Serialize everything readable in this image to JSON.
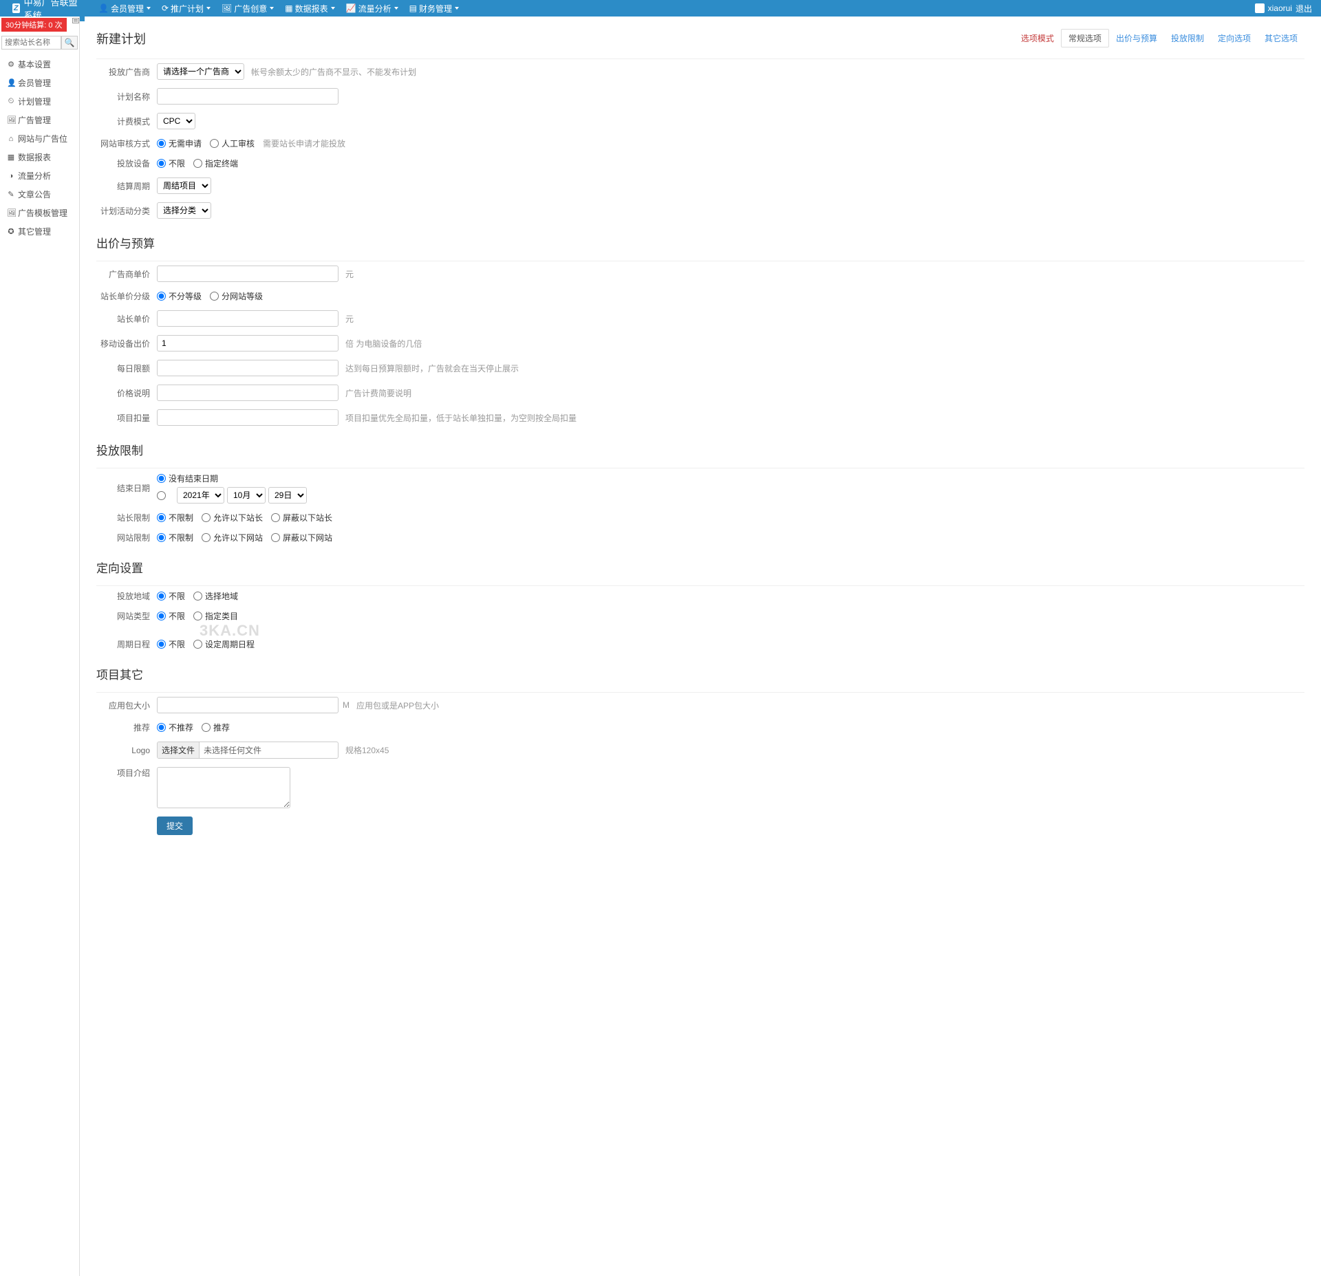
{
  "brand": "中易广告联盟系统",
  "topnav": [
    {
      "icon": "👤",
      "label": "会员管理"
    },
    {
      "icon": "⟳",
      "label": "推广计划"
    },
    {
      "icon": "🖼",
      "label": "广告创意"
    },
    {
      "icon": "▦",
      "label": "数据报表"
    },
    {
      "icon": "📈",
      "label": "流量分析"
    },
    {
      "icon": "▤",
      "label": "财务管理"
    }
  ],
  "user": {
    "name": "xiaorui",
    "logout": "退出"
  },
  "sidebar": {
    "badge": "30分钟结算: 0 次",
    "search_placeholder": "搜索站长名称",
    "items": [
      {
        "icon": "⚙",
        "label": "基本设置"
      },
      {
        "icon": "👤",
        "label": "会员管理"
      },
      {
        "icon": "⏲",
        "label": "计划管理"
      },
      {
        "icon": "🖼",
        "label": "广告管理"
      },
      {
        "icon": "⌂",
        "label": "网站与广告位"
      },
      {
        "icon": "▦",
        "label": "数据报表"
      },
      {
        "icon": "◑",
        "label": "流量分析"
      },
      {
        "icon": "✎",
        "label": "文章公告"
      },
      {
        "icon": "🖼",
        "label": "广告模板管理"
      },
      {
        "icon": "✪",
        "label": "其它管理"
      }
    ]
  },
  "page": {
    "title": "新建计划",
    "tabs": [
      "选项模式",
      "常规选项",
      "出价与预算",
      "投放限制",
      "定向选项",
      "其它选项"
    ]
  },
  "form": {
    "sec1": {
      "advertiser": {
        "label": "投放广告商",
        "option": "请选择一个广告商",
        "hint": "帐号余额太少的广告商不显示、不能发布计划"
      },
      "name": {
        "label": "计划名称"
      },
      "billing": {
        "label": "计费模式",
        "option": "CPC"
      },
      "review": {
        "label": "网站审核方式",
        "r1": "无需申请",
        "r2": "人工审核",
        "hint": "需要站长申请才能投放"
      },
      "device": {
        "label": "投放设备",
        "r1": "不限",
        "r2": "指定终端"
      },
      "cycle": {
        "label": "结算周期",
        "option": "周结项目"
      },
      "category": {
        "label": "计划活动分类",
        "option": "选择分类"
      }
    },
    "sec2": {
      "title": "出价与预算",
      "adv_price": {
        "label": "广告商单价",
        "unit": "元"
      },
      "level": {
        "label": "站长单价分级",
        "r1": "不分等级",
        "r2": "分网站等级"
      },
      "pub_price": {
        "label": "站长单价",
        "unit": "元"
      },
      "mobile": {
        "label": "移动设备出价",
        "value": "1",
        "hint": "倍 为电脑设备的几倍"
      },
      "daily": {
        "label": "每日限额",
        "hint": "达到每日预算限额时，广告就会在当天停止展示"
      },
      "desc": {
        "label": "价格说明",
        "hint": "广告计费简要说明"
      },
      "discount": {
        "label": "项目扣量",
        "hint": "项目扣量优先全局扣量，低于站长单独扣量，为空则按全局扣量"
      }
    },
    "sec3": {
      "title": "投放限制",
      "end": {
        "label": "结束日期",
        "r1": "没有结束日期",
        "y": "2021年",
        "m": "10月",
        "d": "29日"
      },
      "pub": {
        "label": "站长限制",
        "r1": "不限制",
        "r2": "允许以下站长",
        "r3": "屏蔽以下站长"
      },
      "site": {
        "label": "网站限制",
        "r1": "不限制",
        "r2": "允许以下网站",
        "r3": "屏蔽以下网站"
      }
    },
    "sec4": {
      "title": "定向设置",
      "region": {
        "label": "投放地域",
        "r1": "不限",
        "r2": "选择地域"
      },
      "type": {
        "label": "网站类型",
        "r1": "不限",
        "r2": "指定类目"
      },
      "sched": {
        "label": "周期日程",
        "r1": "不限",
        "r2": "设定周期日程"
      }
    },
    "sec5": {
      "title": "项目其它",
      "size": {
        "label": "应用包大小",
        "unit": "M",
        "hint": "应用包或是APP包大小"
      },
      "rec": {
        "label": "推荐",
        "r1": "不推荐",
        "r2": "推荐"
      },
      "logo": {
        "label": "Logo",
        "btn": "选择文件",
        "txt": "未选择任何文件",
        "hint": "规格120x45"
      },
      "intro": {
        "label": "项目介绍"
      }
    },
    "submit": "提交"
  },
  "watermark": "3KA.CN"
}
